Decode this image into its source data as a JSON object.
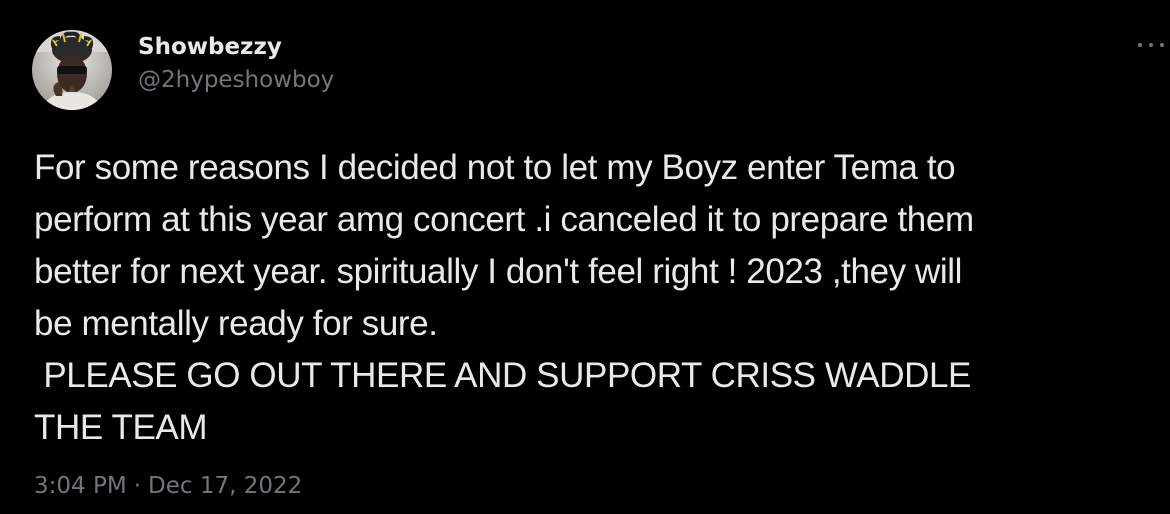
{
  "tweet": {
    "author": {
      "display_name": "Showbezzy",
      "handle": "@2hypeshowboy",
      "avatar_icon": "profile-photo"
    },
    "more_icon": "ellipsis-icon",
    "text_lines": [
      "For some reasons I decided not to let my Boyz enter Tema to",
      "perform at this year amg concert .i canceled it to prepare them",
      "better for next year. spiritually I don't feel right ! 2023 ,they will",
      "be mentally ready for sure.",
      " PLEASE GO OUT THERE AND SUPPORT CRISS WADDLE",
      "THE TEAM"
    ],
    "time": "3:04 PM",
    "separator": "·",
    "date": "Dec 17, 2022"
  },
  "colors": {
    "background": "#000000",
    "primary_text": "#e7e9ea",
    "secondary_text": "#71767b"
  }
}
